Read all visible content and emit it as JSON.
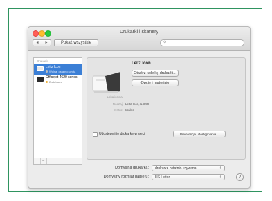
{
  "window": {
    "title": "Drukarki i skanery"
  },
  "toolbar": {
    "back_icon": "chevron-left-icon",
    "forward_icon": "chevron-right-icon",
    "back_label": "◂",
    "forward_label": "▸",
    "show_all_label": "Pokaż wszystkie",
    "search_placeholder": ""
  },
  "sidebar": {
    "header": "Drukarki",
    "printers": [
      {
        "name": "Leitz Icon",
        "status": "Wolna, ostatnio użyta",
        "selected": true
      },
      {
        "name": "Officejet 4620 series",
        "status": "Brak tuszu",
        "selected": false
      }
    ],
    "add_label": "+",
    "remove_label": "−"
  },
  "detail": {
    "printer_name": "Leitz Icon",
    "open_queue_label": "Otwórz kolejkę drukarki...",
    "options_label": "Opcje i materiały",
    "location_label": "Lokalizacja:",
    "location_value": "",
    "type_label": "Rodzaj:",
    "type_value": "Leitz Icon, 1.3.59",
    "status_label": "Status:",
    "status_value": "Wolna",
    "share_label": "Udostępnij tę drukarkę w sieci",
    "share_checked": false,
    "sharing_prefs_label": "Preferencje udostępniania..."
  },
  "bottom": {
    "default_printer_label": "Domyślna drukarka:",
    "default_printer_value": "drukarka ostatnio używana",
    "paper_size_label": "Domyślny rozmiar papieru:",
    "paper_size_value": "US Letter",
    "help_label": "?"
  },
  "colors": {
    "frame_border": "#2f9460",
    "selection": "#3b7fd6"
  }
}
